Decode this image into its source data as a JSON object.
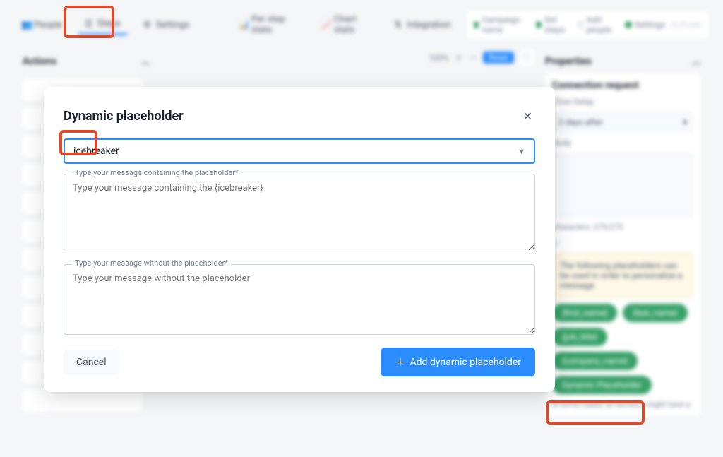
{
  "nav": {
    "people": "People",
    "steps": "Steps",
    "settings": "Settings",
    "per_step_stats": "Per step stats",
    "chart_stats": "Chart stats",
    "integrations": "Integration"
  },
  "wizard": {
    "campaign": "Campaign name",
    "set_steps": "Set steps",
    "add_people": "Add people",
    "settings": "Settings",
    "activate": "Activate"
  },
  "panels": {
    "actions": "Actions",
    "properties": "Properties"
  },
  "zoom": {
    "value": "100%",
    "reset": "Reset"
  },
  "props": {
    "title": "Connection request",
    "time_delay_label": "Time Delay",
    "time_delay_value": "2 days after",
    "body_label": "Body",
    "characters": "Characters: 275/275",
    "info": "The following placeholders can be used in order to personalize a message",
    "pills": {
      "first_name": "{first_name}",
      "last_name": "{last_name}",
      "job_title": "{job_title}",
      "company_name": "{company_name}",
      "dynamic": "Dynamic Placeholder"
    },
    "footnote": "In some cases, an account might have a"
  },
  "modal": {
    "title": "Dynamic placeholder",
    "select_value": "icebreaker",
    "ta1_label": "Type your message containing the placeholder*",
    "ta1_placeholder": "Type your message containing the {icebreaker}",
    "ta2_label": "Type your message without the placeholder*",
    "ta2_placeholder": "Type your message without the placeholder",
    "cancel": "Cancel",
    "add": "Add dynamic placeholder"
  }
}
